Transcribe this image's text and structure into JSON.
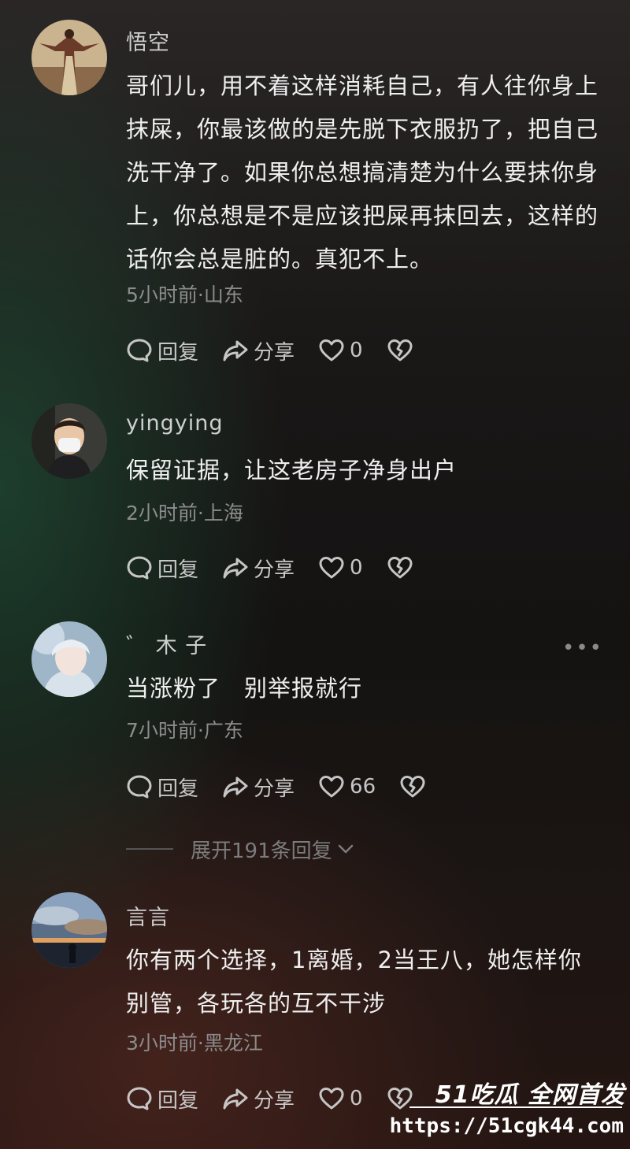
{
  "comments": [
    {
      "username": "悟空",
      "text": "哥们儿，用不着这样消耗自己，有人往你身上抹屎，你最该做的是先脱下衣服扔了，把自己洗干净了。如果你总想搞清楚为什么要抹你身上，你总想是不是应该把屎再抹回去，这样的话你会总是脏的。真犯不上。",
      "meta": "5小时前·山东",
      "reply_label": "回复",
      "share_label": "分享",
      "like_count": "0"
    },
    {
      "username": "yingying",
      "text": "保留证据，让这老房子净身出户",
      "meta": "2小时前·上海",
      "reply_label": "回复",
      "share_label": "分享",
      "like_count": "0"
    },
    {
      "username": "゛ 木 子",
      "text": "当涨粉了　别举报就行",
      "meta": "7小时前·广东",
      "reply_label": "回复",
      "share_label": "分享",
      "like_count": "66",
      "more": "•••"
    },
    {
      "username": "言言",
      "text": "你有两个选择，1离婚，2当王八，她怎样你别管，各玩各的互不干涉",
      "meta": "3小时前·黑龙江",
      "reply_label": "回复",
      "share_label": "分享",
      "like_count": "0"
    }
  ],
  "expand_replies": "展开191条回复",
  "watermark": {
    "logo": "51吃瓜 全网首发",
    "url": "https://51cgk44.com"
  },
  "icons": {
    "reply": "comment-bubble-icon",
    "share": "share-arrow-icon",
    "like": "heart-icon",
    "dislike": "broken-heart-icon",
    "expand": "chevron-down-icon"
  }
}
